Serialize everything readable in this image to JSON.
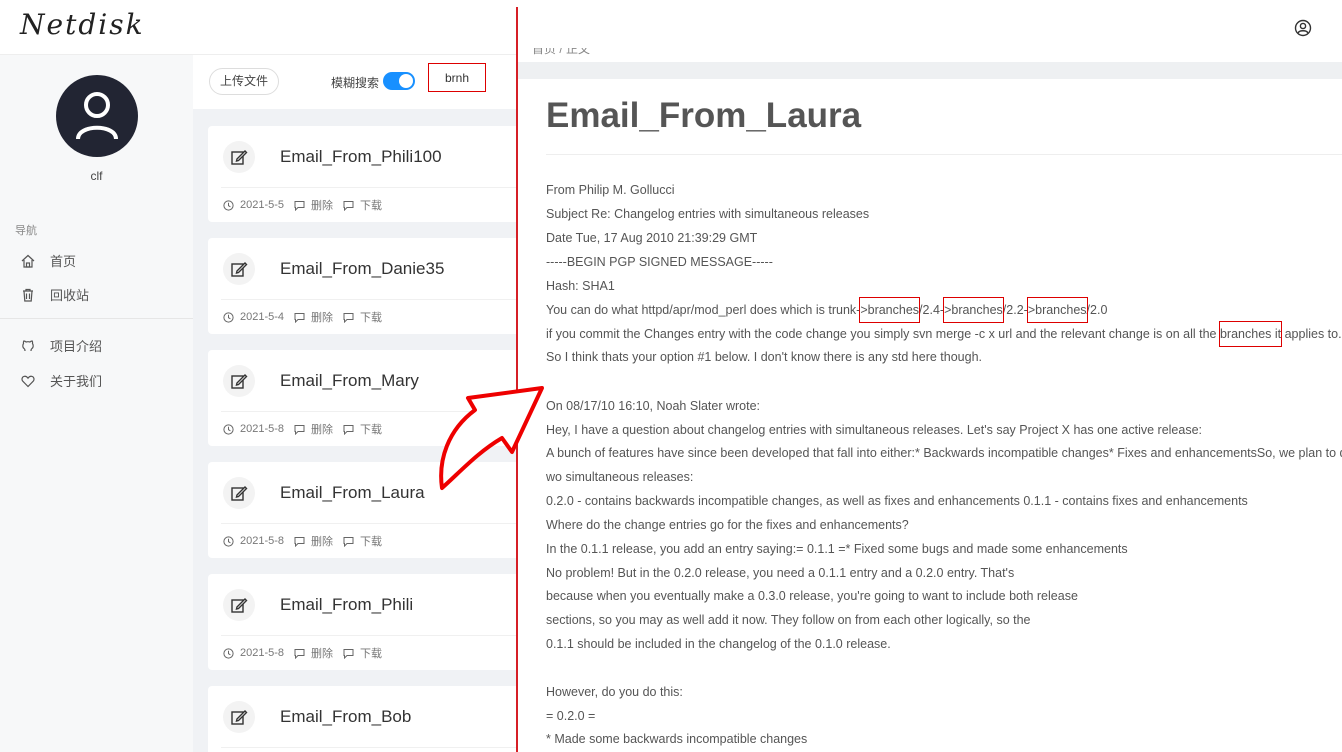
{
  "app": {
    "logo": "Netdisk"
  },
  "sidebar": {
    "username": "clf",
    "nav_title": "导航",
    "items": [
      {
        "label": "首页",
        "icon": "home-icon"
      },
      {
        "label": "回收站",
        "icon": "trash-icon"
      },
      {
        "label": "项目介绍",
        "icon": "github-icon"
      },
      {
        "label": "关于我们",
        "icon": "heart-icon"
      }
    ]
  },
  "toolbar": {
    "upload_label": "上传文件",
    "fuzzy_label": "模糊搜索",
    "fuzzy_enabled": true,
    "search_value": "brnh"
  },
  "files": [
    {
      "title": "Email_From_Phili100",
      "date": "2021-5-5",
      "delete": "删除",
      "download": "下载"
    },
    {
      "title": "Email_From_Danie35",
      "date": "2021-5-4",
      "delete": "删除",
      "download": "下载"
    },
    {
      "title": "Email_From_Mary",
      "date": "2021-5-8",
      "delete": "删除",
      "download": "下载"
    },
    {
      "title": "Email_From_Laura",
      "date": "2021-5-8",
      "delete": "删除",
      "download": "下载"
    },
    {
      "title": "Email_From_Phili",
      "date": "2021-5-8",
      "delete": "删除",
      "download": "下载"
    },
    {
      "title": "Email_From_Bob",
      "date": "",
      "delete": "",
      "download": ""
    }
  ],
  "document": {
    "breadcrumb": "首页 / 正文",
    "title": "Email_From_Laura",
    "highlight_color": "#dd0000",
    "lines": [
      "From    Philip M. Gollucci",
      "Subject     Re: Changelog entries with simultaneous releases",
      "Date    Tue, 17 Aug 2010 21:39:29 GMT",
      "-----BEGIN PGP SIGNED MESSAGE-----",
      "Hash: SHA1",
      "",
      "if you commit the Changes entry with the code change you simply svn merge -c x url and the relevant change is on all the ",
      "So I think thats your option #1 below.  I don't know there is any std here though.",
      "",
      "On 08/17/10 16:10, Noah Slater wrote:",
      " Hey, I have a question about changelog entries with simultaneous releases. Let's say Project X has one active release:",
      "A bunch of features have since been developed that fall into either:* Backwards incompatible changes* Fixes and enhancementsSo, we plan to do t",
      "wo simultaneous releases:",
      "0.2.0 - contains  backwards incompatible changes, as well as fixes and enhancements 0.1.1 - contains fixes and enhancements",
      "Where do the change entries go for the fixes and enhancements?",
      " In the 0.1.1 release, you add an entry saying:= 0.1.1 =* Fixed some bugs and made some enhancements",
      "No problem! But in the 0.2.0 release, you need a 0.1.1 entry and a 0.2.0 entry. That's",
      "because when you eventually make a 0.3.0 release, you're going to want to include both release",
      "sections, so you may as well add it now. They follow on from each other logically, so the",
      "0.1.1 should be included in the changelog of the 0.1.0 release.",
      "",
      "However, do you do this:",
      "= 0.2.0 =",
      "* Made some backwards incompatible changes"
    ],
    "trunk_line": {
      "prefix": "You can do what httpd/apr/mod_perl does which is trunk-",
      "b1": ">branches",
      "s1": "/2.4-",
      "b2": ">branches",
      "s2": "/2.2-",
      "b3": ">branches",
      "s3": "/2.0"
    },
    "commit_line": {
      "hl": "branches it",
      "suffix": " applies to."
    }
  }
}
